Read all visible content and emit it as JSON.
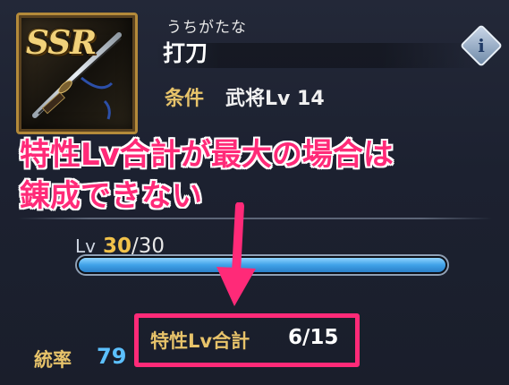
{
  "item": {
    "rarity": "SSR",
    "reading": "うちがたな",
    "name": "打刀",
    "condition_label": "条件",
    "condition_value": "武将Lv 14",
    "icon": "katana-icon"
  },
  "info_button": {
    "glyph": "i",
    "icon": "info-icon"
  },
  "warning": {
    "line1": "特性Lv合計が最大の場合は",
    "line2": "錬成できない",
    "color": "#ff2a78"
  },
  "level": {
    "label": "Lv",
    "current": "30",
    "max": "/30",
    "progress": 1.0
  },
  "stats": {
    "command_label": "統率",
    "command_value": "79"
  },
  "trait_total": {
    "label": "特性Lv合計",
    "value": "6/15"
  },
  "colors": {
    "accent_gold": "#e7c36a",
    "highlight_pink": "#ff2a78",
    "bar_blue": "#3fa2e8",
    "stat_blue": "#5cc0ff"
  }
}
